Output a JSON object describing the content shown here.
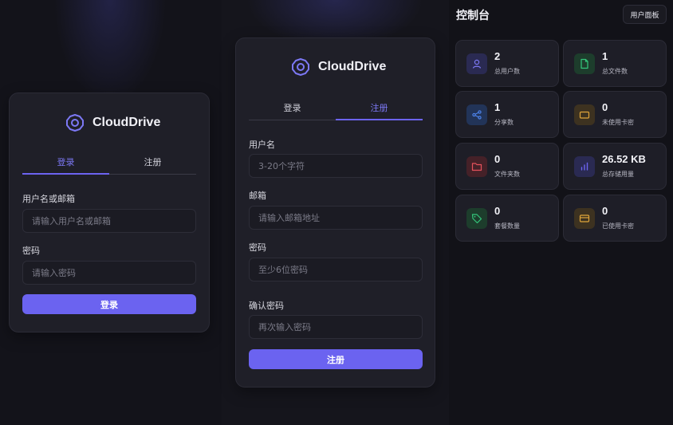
{
  "login": {
    "brand": "CloudDrive",
    "tabs": [
      "登录",
      "注册"
    ],
    "username_label": "用户名或邮箱",
    "username_placeholder": "请输入用户名或邮箱",
    "password_label": "密码",
    "password_placeholder": "请输入密码",
    "submit": "登录"
  },
  "register": {
    "brand": "CloudDrive",
    "tabs": [
      "登录",
      "注册"
    ],
    "username_label": "用户名",
    "username_placeholder": "3-20个字符",
    "email_label": "邮箱",
    "email_placeholder": "请输入邮箱地址",
    "password_label": "密码",
    "password_placeholder": "至少6位密码",
    "confirm_label": "确认密码",
    "confirm_placeholder": "再次输入密码",
    "submit": "注册"
  },
  "dashboard": {
    "title": "控制台",
    "panel_button": "用户面板",
    "stats": [
      {
        "value": "2",
        "label": "总用户数",
        "icon": "user-icon",
        "color": "#7c78f4"
      },
      {
        "value": "1",
        "label": "总文件数",
        "icon": "file-icon",
        "color": "#34c77b"
      },
      {
        "value": "1",
        "label": "分享数",
        "icon": "share-icon",
        "color": "#4f86f0"
      },
      {
        "value": "0",
        "label": "未使用卡密",
        "icon": "card-icon",
        "color": "#e0a53a"
      },
      {
        "value": "0",
        "label": "文件夹数",
        "icon": "folder-icon",
        "color": "#e5525c"
      },
      {
        "value": "26.52 KB",
        "label": "总存储用量",
        "icon": "chart-bar-icon",
        "color": "#6b63f0"
      },
      {
        "value": "0",
        "label": "套餐数量",
        "icon": "tag-icon",
        "color": "#34c77b"
      },
      {
        "value": "0",
        "label": "已使用卡密",
        "icon": "credit-card-icon",
        "color": "#e0a53a"
      }
    ]
  }
}
